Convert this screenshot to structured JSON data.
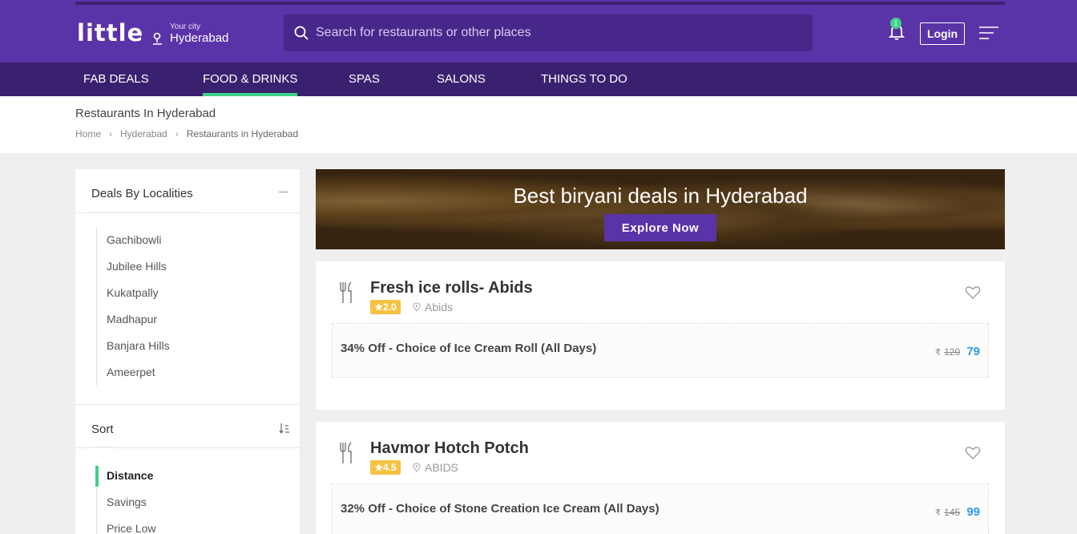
{
  "header": {
    "logo": "little",
    "city_caption": "Your city",
    "city_name": "Hyderabad",
    "search_placeholder": "Search for restaurants or other places",
    "notification_count": "1",
    "login_label": "Login"
  },
  "nav": {
    "items": [
      {
        "label": "FAB DEALS",
        "active": false
      },
      {
        "label": "FOOD & DRINKS",
        "active": true
      },
      {
        "label": "SPAS",
        "active": false
      },
      {
        "label": "SALONS",
        "active": false
      },
      {
        "label": "THINGS TO DO",
        "active": false
      }
    ]
  },
  "page": {
    "title": "Restaurants In Hyderabad",
    "breadcrumb": [
      "Home",
      "Hyderabad",
      "Restaurants in Hyderabad"
    ]
  },
  "sidebar": {
    "localities_title": "Deals By Localities",
    "localities": [
      "Gachibowli",
      "Jubilee Hills",
      "Kukatpally",
      "Madhapur",
      "Banjara Hills",
      "Ameerpet"
    ],
    "sort_title": "Sort",
    "sort_options": [
      "Distance",
      "Savings",
      "Price Low"
    ],
    "sort_active": "Distance"
  },
  "banner": {
    "title": "Best biryani deals in Hyderabad",
    "button_label": "Explore Now"
  },
  "listings": [
    {
      "name": "Fresh ice rolls- Abids",
      "rating": "★2.0",
      "locality": "Abids",
      "deal": "34% Off - Choice of Ice Cream Roll (All Days)",
      "currency": "₹",
      "old_price": "120",
      "new_price": "79"
    },
    {
      "name": "Havmor Hotch Potch",
      "rating": "★4.5",
      "locality": "ABIDS",
      "deal": "32% Off - Choice of Stone Creation Ice Cream (All Days)",
      "currency": "₹",
      "old_price": "145",
      "new_price": "99"
    }
  ],
  "colors": {
    "brand": "#5b33a8",
    "nav_bg": "#3a2170",
    "accent": "#3ed18c",
    "rating": "#f5c242",
    "price": "#2d9bf0"
  }
}
